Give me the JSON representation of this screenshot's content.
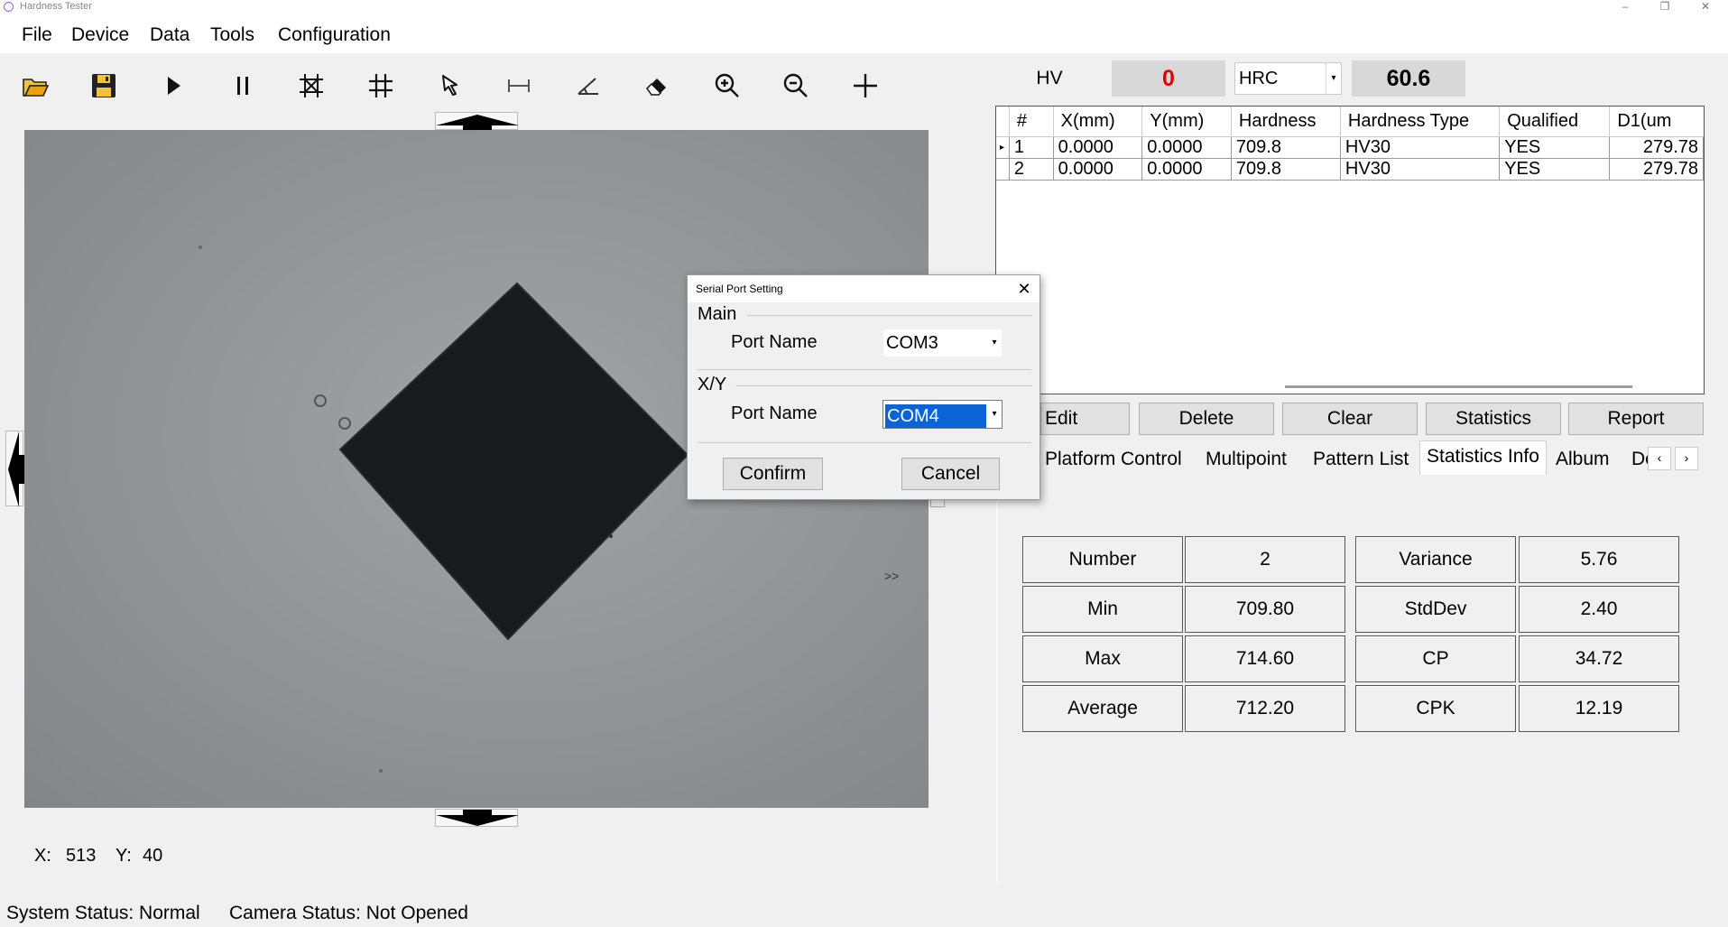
{
  "window": {
    "title": "Hardness Tester",
    "minimize": "–",
    "maximize": "❐",
    "close": "✕"
  },
  "menu": [
    "File",
    "Device",
    "Data",
    "Tools",
    "Configuration"
  ],
  "toolbar": [
    "open-folder",
    "save",
    "play",
    "pause",
    "crosshair-measure",
    "grid",
    "pointer",
    "measure-distance",
    "measure-angle",
    "eraser",
    "zoom-in",
    "zoom-out",
    "add"
  ],
  "readout": {
    "hv_label": "HV",
    "hv_value": "0",
    "scale_select": "HRC",
    "converted_value": "60.6",
    "hv_color": "#e00000"
  },
  "table": {
    "columns": [
      "#",
      "X(mm)",
      "Y(mm)",
      "Hardness",
      "Hardness Type",
      "Qualified",
      "D1(um"
    ],
    "rows": [
      [
        "1",
        "0.0000",
        "0.0000",
        "709.8",
        "HV30",
        "YES",
        "279.78"
      ],
      [
        "2",
        "0.0000",
        "0.0000",
        "709.8",
        "HV30",
        "YES",
        "279.78"
      ]
    ]
  },
  "actions": [
    "Edit",
    "Delete",
    "Clear",
    "Statistics",
    "Report"
  ],
  "tabs": [
    "Platform Control",
    "Multipoint",
    "Pattern List",
    "Statistics Info",
    "Album",
    "De"
  ],
  "tab_scroll": {
    "left": "‹",
    "right": "›"
  },
  "statistics": [
    [
      "Number",
      "2",
      "Variance",
      "5.76"
    ],
    [
      "Min",
      "709.80",
      "StdDev",
      "2.40"
    ],
    [
      "Max",
      "714.60",
      "CP",
      "34.72"
    ],
    [
      "Average",
      "712.20",
      "CPK",
      "12.19"
    ]
  ],
  "coords": {
    "x_label": "X:",
    "x": "513",
    "y_label": "Y:",
    "y": "40"
  },
  "status": {
    "system": "System Status: Normal",
    "camera": "Camera Status: Not Opened"
  },
  "dialog": {
    "title": "Serial Port Setting",
    "close": "✕",
    "main_group": "Main",
    "main_port_label": "Port Name",
    "main_port_value": "COM3",
    "xy_group": "X/Y",
    "xy_port_label": "Port Name",
    "xy_port_value": "COM4",
    "confirm": "Confirm",
    "cancel": "Cancel"
  },
  "image_annotation": ">>"
}
